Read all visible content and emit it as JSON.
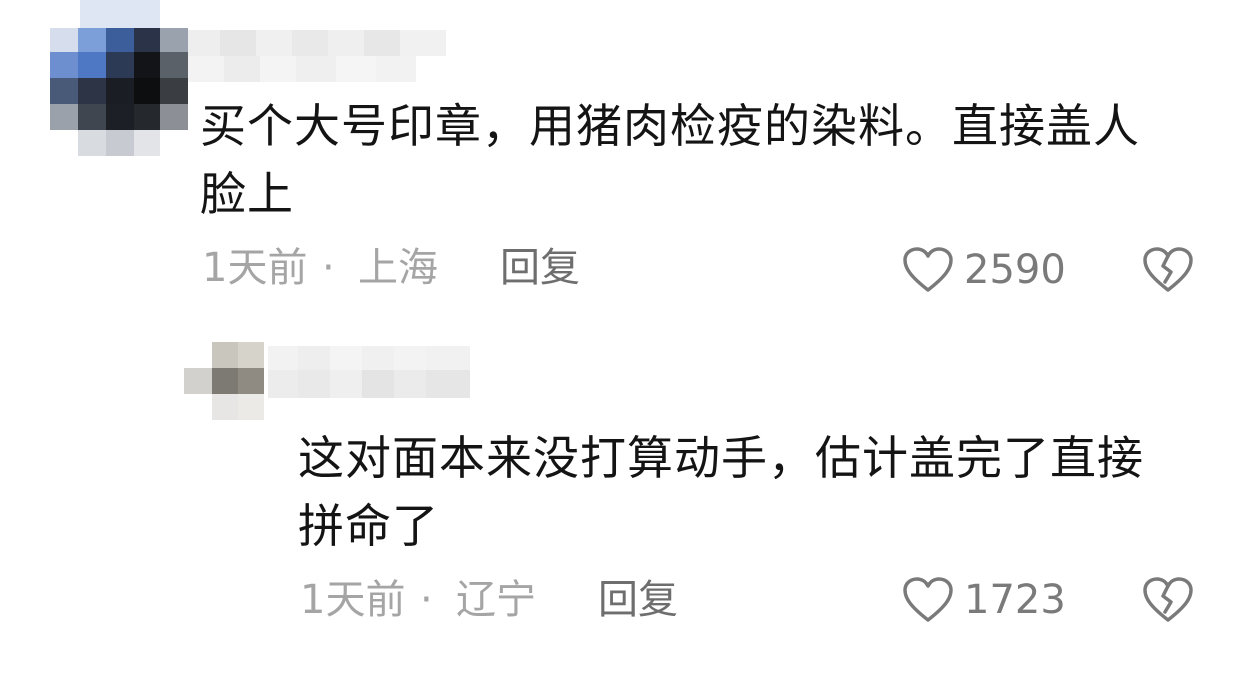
{
  "comments": [
    {
      "text_line1": "买个大号印章，用猪肉检疫的染料。直接盖人",
      "text_line2": "脸上",
      "time": "1天前",
      "separator": "·",
      "location": "上海",
      "reply_label": "回复",
      "like_count": "2590"
    },
    {
      "text_line1": "这对面本来没打算动手，估计盖完了直接",
      "text_line2": "拼命了",
      "time": "1天前",
      "separator": "·",
      "location": "辽宁",
      "reply_label": "回复",
      "like_count": "1723"
    }
  ],
  "icons": {
    "like": "heart-outline-icon",
    "dislike": "broken-heart-icon"
  },
  "colors": {
    "text": "#141414",
    "meta": "#a5a5a5",
    "reply": "#6e6e6e",
    "icon": "#7a7a7a"
  }
}
